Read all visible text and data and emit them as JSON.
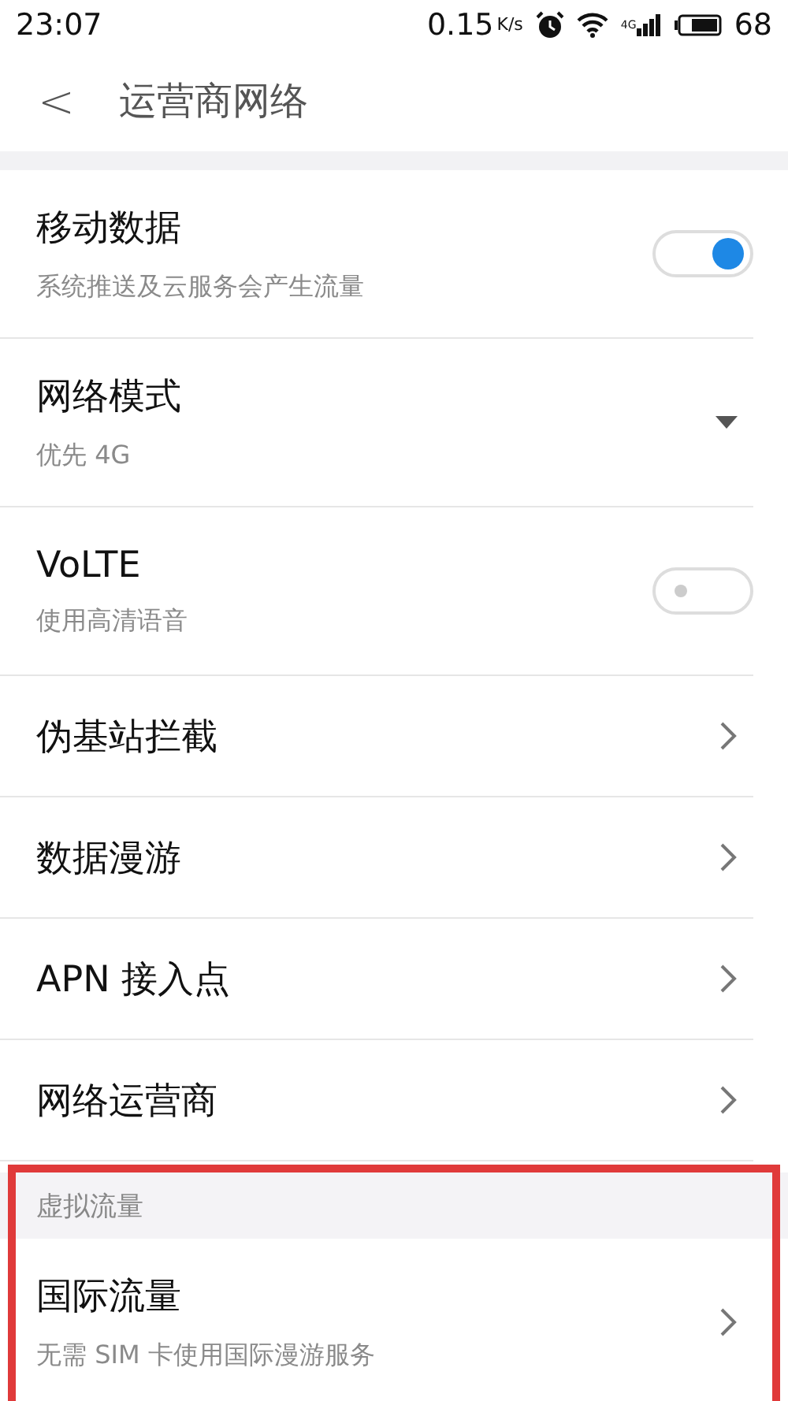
{
  "status_bar": {
    "time": "23:07",
    "speed": "0.15",
    "speed_unit": "K/s",
    "network": "4G",
    "battery": "68"
  },
  "header": {
    "back": "<",
    "title": "运营商网络"
  },
  "rows": [
    {
      "kind": "toggle",
      "title": "移动数据",
      "subtitle": "系统推送及云服务会产生流量",
      "on": true
    },
    {
      "kind": "dropdown",
      "title": "网络模式",
      "subtitle": "优先 4G"
    },
    {
      "kind": "toggle",
      "title": "VoLTE",
      "subtitle": "使用高清语音",
      "on": false
    },
    {
      "kind": "chevron",
      "title": "伪基站拦截"
    },
    {
      "kind": "chevron",
      "title": "数据漫游"
    },
    {
      "kind": "chevron",
      "title": "APN 接入点"
    },
    {
      "kind": "chevron",
      "title": "网络运营商"
    }
  ],
  "section": {
    "title": "虚拟流量",
    "highlighted": true,
    "rows": [
      {
        "kind": "chevron",
        "title": "国际流量",
        "subtitle": "无需 SIM 卡使用国际漫游服务"
      }
    ]
  }
}
